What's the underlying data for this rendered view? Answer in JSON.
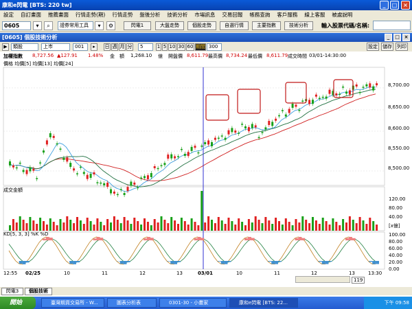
{
  "window": {
    "title": "康和e閃電 [BTS: 220 tw]"
  },
  "menu": [
    "設定",
    "自訂畫面",
    "推薦畫面",
    "行情走勢(期)",
    "行情走勢",
    "盤後分析",
    "技術分析",
    "市場訊息",
    "交易回報",
    "帳務查詢",
    "客戶服務",
    "線上客服",
    "被處說明"
  ],
  "toolbar": {
    "code": "0605",
    "tool_select": "證券常用工具",
    "buttons": [
      "閃電1",
      "大盤走勢",
      "個股走勢",
      "自選行情",
      "主要指數",
      "技術分析"
    ],
    "search_label": "輸入股票代碼/名稱:"
  },
  "subwindow": {
    "title": "[0605] 個股技術分析"
  },
  "controls": {
    "category": "類股",
    "market": "上市",
    "number": "001",
    "periods": [
      "日",
      "週",
      "月",
      "分"
    ],
    "interval": "5",
    "steps": [
      "1",
      "5",
      "10",
      "30",
      "60",
      "期間"
    ],
    "period_value": "300",
    "right_buttons": [
      "設定",
      "儲存",
      "列印"
    ]
  },
  "info": {
    "name": "加權指數",
    "price": "8,727.56",
    "change": "▲127.91",
    "pct": "1.48%",
    "amount_label": "金　額",
    "amount": "1,268.10",
    "amount_unit": "億",
    "open_label": "開盤價",
    "open": "8,611.79",
    "high_label": "最高價",
    "high": "8,734.24",
    "low_label": "最低價",
    "low": "8,611.79",
    "time_label": "成交時間",
    "time": "03/01-14:30:00"
  },
  "price_panel": {
    "legend": "價格 均價[5] 均價[13] 均價[24]",
    "y_ticks": [
      "8,700.00",
      "8,650.00",
      "8,600.00",
      "8,550.00",
      "8,500.00"
    ]
  },
  "volume_panel": {
    "label": "成交金額",
    "y_ticks": [
      "120.00",
      "80.00",
      "40.00"
    ],
    "unit": "[x億]"
  },
  "kd_panel": {
    "label": "KD[5, 3, 3]  %K  %D",
    "y_ticks": [
      "100.00",
      "80.00",
      "60.00",
      "40.00",
      "20.00",
      "0.00"
    ]
  },
  "x_axis": {
    "labels": [
      "12:55",
      "02/25",
      "10",
      "11",
      "12",
      "13",
      "03/01",
      "10",
      "11",
      "12",
      "13",
      "13:30"
    ]
  },
  "scroll_value": "119",
  "tabs": [
    "閃電3",
    "個股技術"
  ],
  "taskbar": {
    "start": "開始",
    "tasks": [
      "臺灣期貨交易所 - W...",
      "圖表分析表",
      "0301-30 - 小畫家",
      "康和e閃電 [BTS: 22..."
    ],
    "time": "下午 09:58"
  },
  "colors": {
    "up": "#e02020",
    "down": "#18a018",
    "ma5": "#40a0e0",
    "ma13": "#207040",
    "ma24": "#d02020",
    "crosshair": "#3030d0"
  }
}
